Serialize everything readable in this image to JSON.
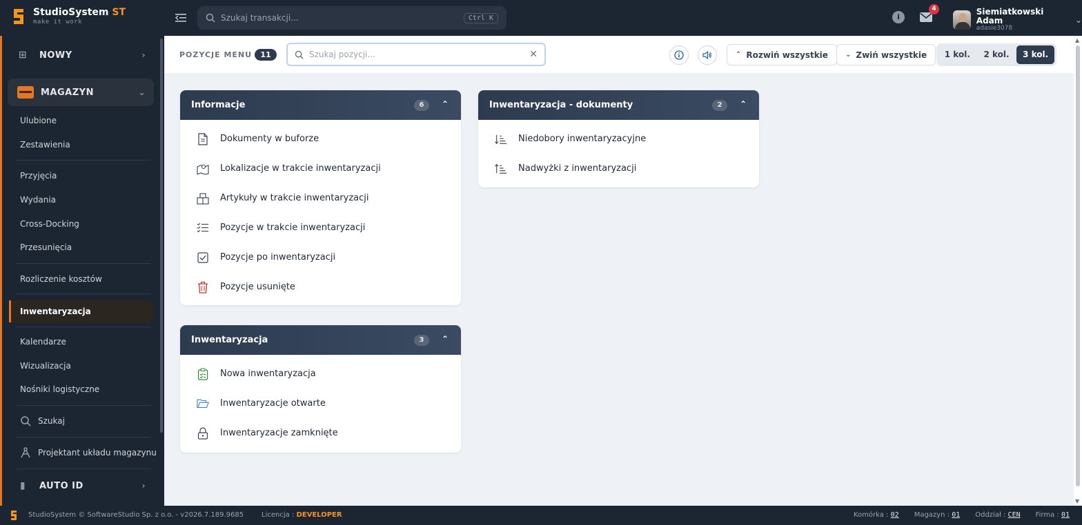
{
  "app": {
    "name": "StudioSystem",
    "name_suffix": "ST",
    "tagline": "make it work"
  },
  "topbar": {
    "search_placeholder": "Szukaj transakcji...",
    "search_shortcut": "Ctrl K",
    "info_icon": "info-icon",
    "mail_count": "4",
    "user_name": "Siemiatkowski Adam",
    "user_login": "adasie3078"
  },
  "sidebar": {
    "new_label": "NOWY",
    "magazyn_label": "MAGAZYN",
    "items": [
      "Ulubione",
      "Zestawienia",
      "Przyjęcia",
      "Wydania",
      "Cross-Docking",
      "Przesunięcia",
      "Rozliczenie kosztów",
      "Inwentaryzacja",
      "Kalendarze",
      "Wizualizacja",
      "Nośniki logistyczne"
    ],
    "active_item": "Inwentaryzacja",
    "tools": {
      "search": "Szukaj",
      "designer": "Projektant układu magazynu"
    },
    "autoid_label": "AUTO ID"
  },
  "toolbar": {
    "title": "POZYCJE MENU",
    "count": "11",
    "search_placeholder": "Szukaj pozycji...",
    "expand_all": "Rozwiń wszystkie",
    "collapse_all": "Zwiń wszystkie",
    "columns": [
      "1 kol.",
      "2 kol.",
      "3 kol."
    ],
    "active_column": "3 kol."
  },
  "cards": {
    "informacje": {
      "title": "Informacje",
      "count": "6",
      "items": [
        "Dokumenty w buforze",
        "Lokalizacje w trakcie inwentaryzacji",
        "Artykuły w trakcie inwentaryzacji",
        "Pozycje w trakcie inwentaryzacji",
        "Pozycje po inwentaryzacji",
        "Pozycje usunięte"
      ]
    },
    "inwentaryzacja": {
      "title": "Inwentaryzacja",
      "count": "3",
      "items": [
        "Nowa inwentaryzacja",
        "Inwentaryzacje otwarte",
        "Inwentaryzacje zamknięte"
      ]
    },
    "dokumenty": {
      "title": "Inwentaryzacja - dokumenty",
      "count": "2",
      "items": [
        "Niedobory inwentaryzacyjne",
        "Nadwyżki z inwentaryzacji"
      ]
    }
  },
  "footer": {
    "copyright": "StudioSystem © SoftwareStudio Sp. z o.o. - v2026.7.189.9685",
    "license_label": "Licencja :",
    "license_value": "DEVELOPER",
    "komorka_label": "Komórka :",
    "komorka_value": "02",
    "magazyn_label": "Magazyn :",
    "magazyn_value": "01",
    "oddzial_label": "Oddział :",
    "oddzial_value": "CEN",
    "firma_label": "Firma :",
    "firma_value": "01"
  },
  "colors": {
    "brand_orange": "#f7941d",
    "dark_bg": "#1c2532",
    "card_header": "#2d3b4e",
    "danger_red": "#c0392b",
    "success_green": "#2e8b3a",
    "folder_blue": "#3b82c4"
  }
}
